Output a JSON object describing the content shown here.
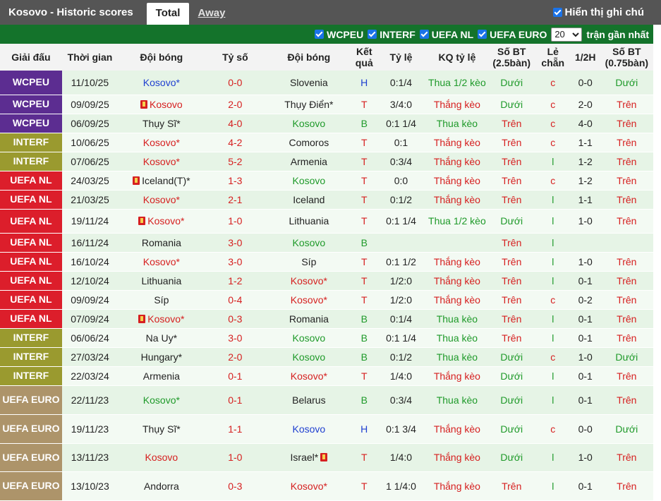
{
  "header": {
    "title": "Kosovo - Historic scores",
    "tabs": [
      {
        "label": "Total"
      },
      {
        "label": "Away"
      }
    ],
    "show_all_label": "Hiển thị ghi chú"
  },
  "filters": {
    "items": [
      {
        "label": "WCPEU"
      },
      {
        "label": "INTERF"
      },
      {
        "label": "UEFA NL"
      },
      {
        "label": "UEFA EURO"
      }
    ],
    "count_value": "20",
    "count_suffix": "trận gần nhất"
  },
  "table": {
    "columns": [
      "Giải đấu",
      "Thời gian",
      "Đội bóng",
      "Tỷ số",
      "Đội bóng",
      "Kết quả",
      "Tỷ lệ",
      "KQ tỷ lệ",
      "Số BT (2.5bàn)",
      "Lẻ chẵn",
      "1/2H",
      "Số BT (0.75bàn)"
    ],
    "rows": [
      {
        "league": "WCPEU",
        "date": "11/10/25",
        "home": "Kosovo*",
        "score": "0-0",
        "away": "Slovenia",
        "result": "H",
        "odds": "0:1/4",
        "odds_result": "Thua 1/2 kèo",
        "ou": "Dưới",
        "oe": "c",
        "half": "0-0",
        "ou075": "Dưới"
      },
      {
        "league": "WCPEU",
        "date": "09/09/25",
        "home": "Kosovo",
        "score": "2-0",
        "away": "Thụy Điển*",
        "result": "T",
        "odds": "3/4:0",
        "odds_result": "Thắng kèo",
        "ou": "Dưới",
        "oe": "c",
        "half": "2-0",
        "ou075": "Trên"
      },
      {
        "league": "WCPEU",
        "date": "06/09/25",
        "home": "Thụy Sĩ*",
        "score": "4-0",
        "away": "Kosovo",
        "result": "B",
        "odds": "0:1 1/4",
        "odds_result": "Thua kèo",
        "ou": "Trên",
        "oe": "c",
        "half": "4-0",
        "ou075": "Trên"
      },
      {
        "league": "INTERF",
        "date": "10/06/25",
        "home": "Kosovo*",
        "score": "4-2",
        "away": "Comoros",
        "result": "T",
        "odds": "0:1",
        "odds_result": "Thắng kèo",
        "ou": "Trên",
        "oe": "c",
        "half": "1-1",
        "ou075": "Trên"
      },
      {
        "league": "INTERF",
        "date": "07/06/25",
        "home": "Kosovo*",
        "score": "5-2",
        "away": "Armenia",
        "result": "T",
        "odds": "0:3/4",
        "odds_result": "Thắng kèo",
        "ou": "Trên",
        "oe": "l",
        "half": "1-2",
        "ou075": "Trên"
      },
      {
        "league": "UEFA NL",
        "date": "24/03/25",
        "home": "Iceland(T)*",
        "score": "1-3",
        "away": "Kosovo",
        "result": "T",
        "odds": "0:0",
        "odds_result": "Thắng kèo",
        "ou": "Trên",
        "oe": "c",
        "half": "1-2",
        "ou075": "Trên"
      },
      {
        "league": "UEFA NL",
        "date": "21/03/25",
        "home": "Kosovo*",
        "score": "2-1",
        "away": "Iceland",
        "result": "T",
        "odds": "0:1/2",
        "odds_result": "Thắng kèo",
        "ou": "Trên",
        "oe": "l",
        "half": "1-1",
        "ou075": "Trên"
      },
      {
        "league": "UEFA NL",
        "date": "19/11/24",
        "home": "Kosovo*",
        "score": "1-0",
        "away": "Lithuania",
        "result": "T",
        "odds": "0:1 1/4",
        "odds_result": "Thua 1/2 kèo",
        "ou": "Dưới",
        "oe": "l",
        "half": "1-0",
        "ou075": "Trên"
      },
      {
        "league": "UEFA NL",
        "date": "16/11/24",
        "home": "Romania",
        "score": "3-0",
        "away": "Kosovo",
        "result": "B",
        "odds": "",
        "odds_result": "",
        "ou": "Trên",
        "oe": "l",
        "half": "",
        "ou075": ""
      },
      {
        "league": "UEFA NL",
        "date": "16/10/24",
        "home": "Kosovo*",
        "score": "3-0",
        "away": "Síp",
        "result": "T",
        "odds": "0:1 1/2",
        "odds_result": "Thắng kèo",
        "ou": "Trên",
        "oe": "l",
        "half": "1-0",
        "ou075": "Trên"
      },
      {
        "league": "UEFA NL",
        "date": "12/10/24",
        "home": "Lithuania",
        "score": "1-2",
        "away": "Kosovo*",
        "result": "T",
        "odds": "1/2:0",
        "odds_result": "Thắng kèo",
        "ou": "Trên",
        "oe": "l",
        "half": "0-1",
        "ou075": "Trên"
      },
      {
        "league": "UEFA NL",
        "date": "09/09/24",
        "home": "Síp",
        "score": "0-4",
        "away": "Kosovo*",
        "result": "T",
        "odds": "1/2:0",
        "odds_result": "Thắng kèo",
        "ou": "Trên",
        "oe": "c",
        "half": "0-2",
        "ou075": "Trên"
      },
      {
        "league": "UEFA NL",
        "date": "07/09/24",
        "home": "Kosovo*",
        "score": "0-3",
        "away": "Romania",
        "result": "B",
        "odds": "0:1/4",
        "odds_result": "Thua kèo",
        "ou": "Trên",
        "oe": "l",
        "half": "0-1",
        "ou075": "Trên"
      },
      {
        "league": "INTERF",
        "date": "06/06/24",
        "home": "Na Uy*",
        "score": "3-0",
        "away": "Kosovo",
        "result": "B",
        "odds": "0:1 1/4",
        "odds_result": "Thua kèo",
        "ou": "Trên",
        "oe": "l",
        "half": "0-1",
        "ou075": "Trên"
      },
      {
        "league": "INTERF",
        "date": "27/03/24",
        "home": "Hungary*",
        "score": "2-0",
        "away": "Kosovo",
        "result": "B",
        "odds": "0:1/2",
        "odds_result": "Thua kèo",
        "ou": "Dưới",
        "oe": "c",
        "half": "1-0",
        "ou075": "Dưới"
      },
      {
        "league": "INTERF",
        "date": "22/03/24",
        "home": "Armenia",
        "score": "0-1",
        "away": "Kosovo*",
        "result": "T",
        "odds": "1/4:0",
        "odds_result": "Thắng kèo",
        "ou": "Dưới",
        "oe": "l",
        "half": "0-1",
        "ou075": "Trên"
      },
      {
        "league": "UEFA EURO",
        "date": "22/11/23",
        "home": "Kosovo*",
        "score": "0-1",
        "away": "Belarus",
        "result": "B",
        "odds": "0:3/4",
        "odds_result": "Thua kèo",
        "ou": "Dưới",
        "oe": "l",
        "half": "0-1",
        "ou075": "Trên"
      },
      {
        "league": "UEFA EURO",
        "date": "19/11/23",
        "home": "Thụy Sĩ*",
        "score": "1-1",
        "away": "Kosovo",
        "result": "H",
        "odds": "0:1 3/4",
        "odds_result": "Thắng kèo",
        "ou": "Dưới",
        "oe": "c",
        "half": "0-0",
        "ou075": "Dưới"
      },
      {
        "league": "UEFA EURO",
        "date": "13/11/23",
        "home": "Kosovo",
        "score": "1-0",
        "away": "Israel*",
        "result": "T",
        "odds": "1/4:0",
        "odds_result": "Thắng kèo",
        "ou": "Dưới",
        "oe": "l",
        "half": "1-0",
        "ou075": "Trên"
      },
      {
        "league": "UEFA EURO",
        "date": "13/10/23",
        "home": "Andorra",
        "score": "0-3",
        "away": "Kosovo*",
        "result": "T",
        "odds": "1 1/4:0",
        "odds_result": "Thắng kèo",
        "ou": "Trên",
        "oe": "l",
        "half": "0-1",
        "ou075": "Trên"
      }
    ]
  }
}
